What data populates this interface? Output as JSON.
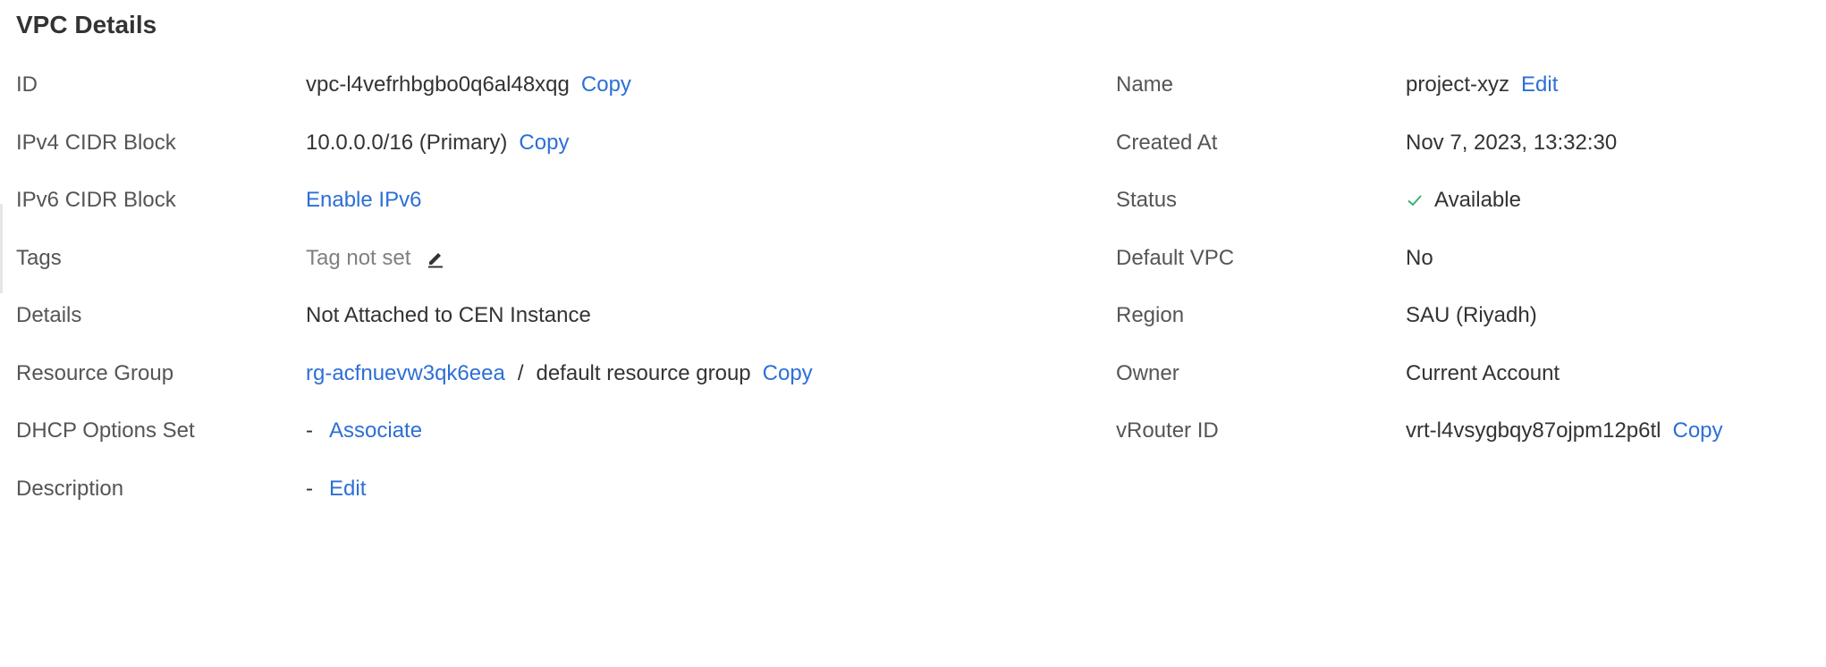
{
  "title": "VPC Details",
  "left": {
    "id": {
      "label": "ID",
      "value": "vpc-l4vefrhbgbo0q6al48xqg",
      "copy": "Copy"
    },
    "ipv4": {
      "label": "IPv4 CIDR Block",
      "value": "10.0.0.0/16 (Primary)",
      "copy": "Copy"
    },
    "ipv6": {
      "label": "IPv6 CIDR Block",
      "action": "Enable IPv6"
    },
    "tags": {
      "label": "Tags",
      "value": "Tag not set",
      "icon": "edit-icon"
    },
    "details": {
      "label": "Details",
      "value": "Not Attached to CEN Instance"
    },
    "resource_group": {
      "label": "Resource Group",
      "id": "rg-acfnuevw3qk6eea",
      "separator": "/",
      "name": "default resource group",
      "copy": "Copy"
    },
    "dhcp": {
      "label": "DHCP Options Set",
      "value": "-",
      "action": "Associate"
    },
    "description": {
      "label": "Description",
      "value": "-",
      "action": "Edit"
    }
  },
  "right": {
    "name": {
      "label": "Name",
      "value": "project-xyz",
      "action": "Edit"
    },
    "created_at": {
      "label": "Created At",
      "value": "Nov 7, 2023, 13:32:30"
    },
    "status": {
      "label": "Status",
      "value": "Available",
      "icon": "check-icon",
      "color": "#3cb371"
    },
    "default_vpc": {
      "label": "Default VPC",
      "value": "No"
    },
    "region": {
      "label": "Region",
      "value": "SAU (Riyadh)"
    },
    "owner": {
      "label": "Owner",
      "value": "Current Account"
    },
    "vrouter": {
      "label": "vRouter ID",
      "value": "vrt-l4vsygbqy87ojpm12p6tl",
      "copy": "Copy"
    }
  },
  "colors": {
    "link": "#2d6fd6",
    "label": "#555555",
    "text": "#333333",
    "muted": "#808080"
  }
}
